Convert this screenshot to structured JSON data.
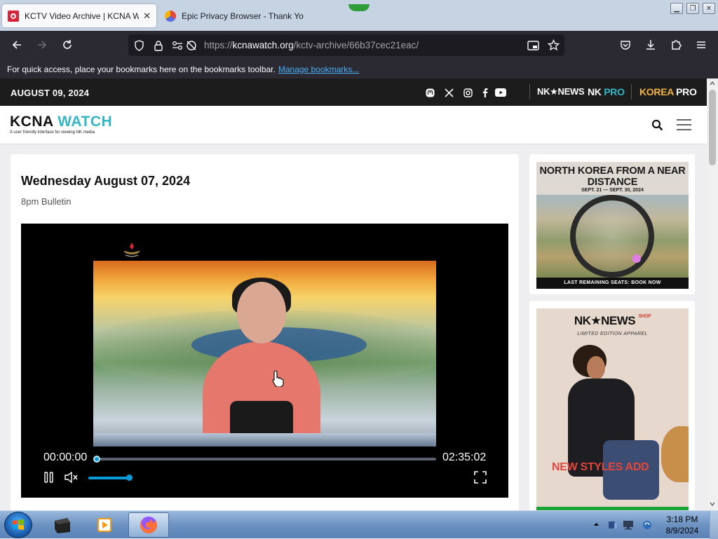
{
  "browser": {
    "tabs": [
      {
        "title": "KCTV Video Archive | KCNA Wa",
        "favicon_color": "#d8243a",
        "active": true
      },
      {
        "title": "Epic Privacy Browser - Thank Yo",
        "favicon_color": "#5a6be0",
        "active": false
      }
    ],
    "url": {
      "prefix": "https://",
      "domain": "kcnawatch.org",
      "path": "/kctv-archive/66b37cec21eac/"
    },
    "bookmarks_text": "For quick access, place your bookmarks here on the bookmarks toolbar.",
    "bookmarks_link": "Manage bookmarks..."
  },
  "site": {
    "date": "AUGUST 09, 2024",
    "social": [
      "mastodon-icon",
      "x-icon",
      "instagram-icon",
      "facebook-icon",
      "youtube-icon"
    ],
    "brands": {
      "nknews": "NK★NEWS",
      "nkpro_nk": "NK ",
      "nkpro_pro": "PRO",
      "korea": "KOREA ",
      "korea_pro": "PRO"
    },
    "logo_main": "KCNA ",
    "logo_accent": "WATCH",
    "logo_tagline": "A user friendly interface for viewing NK media",
    "accent_color": "#35b6c4"
  },
  "article": {
    "title": "Wednesday August 07, 2024",
    "subtitle": "8pm Bulletin"
  },
  "video": {
    "current_time": "00:00:00",
    "duration": "02:35:02",
    "progress": 0.0,
    "volume": 1.0
  },
  "ads": {
    "ad1": {
      "title": "NORTH KOREA FROM A NEAR DISTANCE",
      "dates": "SEPT. 21 — SEPT. 30, 2024",
      "footer": "LAST REMAINING SEATS: BOOK NOW"
    },
    "ad2": {
      "logo": "NK★NEWS",
      "shop": "SHOP",
      "tag": "LIMITED EDITION APPAREL",
      "promo": "NEW STYLES ADD"
    }
  },
  "taskbar": {
    "time": "3:18 PM",
    "date": "8/9/2024"
  }
}
